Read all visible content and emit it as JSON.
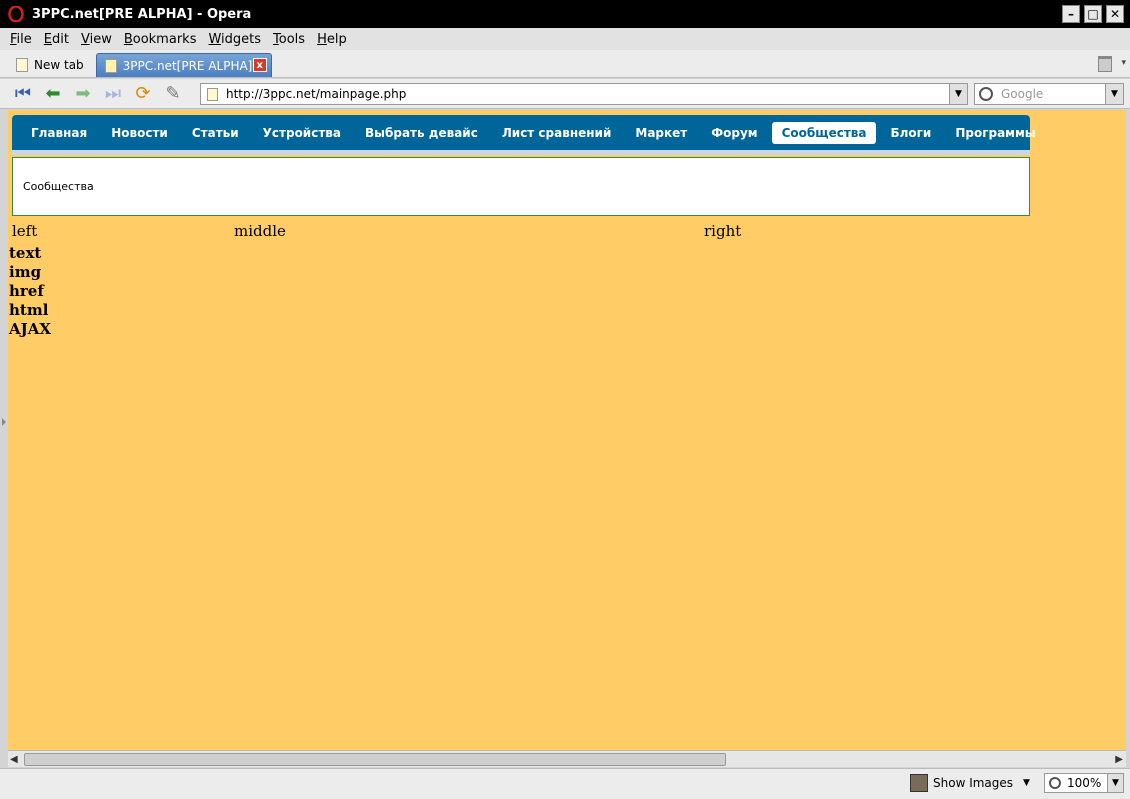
{
  "window": {
    "title": "3PPC.net[PRE ALPHA] - Opera",
    "controls": {
      "minimize": "–",
      "maximize": "□",
      "close": "✕"
    }
  },
  "menubar": {
    "items": [
      {
        "label": "File",
        "accel": "F"
      },
      {
        "label": "Edit",
        "accel": "E"
      },
      {
        "label": "View",
        "accel": "V"
      },
      {
        "label": "Bookmarks",
        "accel": "B"
      },
      {
        "label": "Widgets",
        "accel": "W"
      },
      {
        "label": "Tools",
        "accel": "T"
      },
      {
        "label": "Help",
        "accel": "H"
      }
    ]
  },
  "tabs": {
    "new_tab_label": "New tab",
    "active_tab_label": "3PPC.net[PRE ALPHA]",
    "close_glyph": "x"
  },
  "toolbar": {
    "address": "http://3ppc.net/mainpage.php",
    "search_placeholder": "Google"
  },
  "site": {
    "nav": [
      "Главная",
      "Новости",
      "Статьи",
      "Устройства",
      "Выбрать девайс",
      "Лист сравнений",
      "Маркет",
      "Форум",
      "Сообщества",
      "Блоги",
      "Программы"
    ],
    "active_nav": "Сообщества",
    "subheader": "Сообщества",
    "columns": {
      "left": "left",
      "middle": "middle",
      "right": "right"
    },
    "types": [
      "text",
      "img",
      "href",
      "html",
      "AJAX"
    ]
  },
  "statusbar": {
    "show_images": "Show Images",
    "zoom": "100%"
  },
  "colors": {
    "page_bg": "#ffcc66",
    "nav_bg": "#006699",
    "subheader_border": "#3a8a3a"
  }
}
